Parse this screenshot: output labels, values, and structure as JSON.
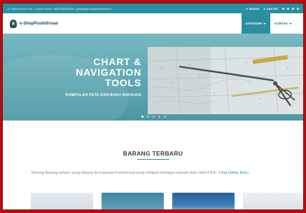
{
  "topbar": {
    "address": "Jl. Pantai Kuta V No. 1, Ancol Timur, +6281290000000, pusdatinpur@pushidrosal.id",
    "login_label": "MASUK",
    "register_label": "DAFTAR"
  },
  "header": {
    "logo_text": "e-ShopPushidrosal",
    "nav": [
      {
        "label": "KATEGORI",
        "active": true
      },
      {
        "label": "KONTAK",
        "active": false
      }
    ]
  },
  "hero": {
    "title_line1": "CHART &",
    "title_line2": "NAVIGATION",
    "title_line3": "TOOLS",
    "subtitle": "KUMPULAN PETA DAN BUKU NAVIGASI",
    "slide_count": 5,
    "active_slide": 1
  },
  "latest": {
    "title": "BARANG TERBARU",
    "description": "Barang-Barang terbaru yang datang ke koperasi Pushidrosal yang meliputi berbagai macam buku NAUTIKA .",
    "link_text": "Lihat Daftar Buku"
  },
  "colors": {
    "frame": "#b70d10",
    "accent": "#2a8fa3",
    "hero": "#5ea6b1"
  }
}
